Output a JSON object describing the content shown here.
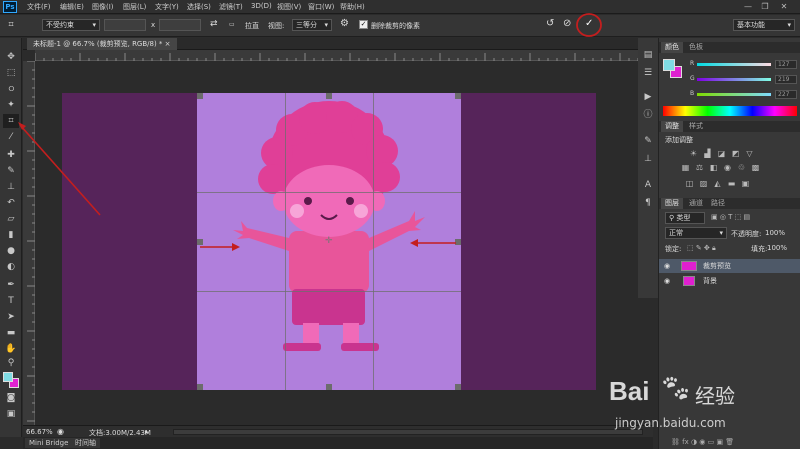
{
  "menubar": {
    "logo": "Ps",
    "items": [
      "文件(F)",
      "编辑(E)",
      "图像(I)",
      "图层(L)",
      "文字(Y)",
      "选择(S)",
      "滤镜(T)",
      "3D(D)",
      "视图(V)",
      "窗口(W)",
      "帮助(H)"
    ],
    "window_controls": [
      "—",
      "❐",
      "✕"
    ]
  },
  "options_bar": {
    "ratio_select": "不受约束",
    "swap_symbol": "x",
    "straighten_label": "拉直",
    "view_label": "视图:",
    "view_select": "三等分",
    "delete_pixels_label": "删除裁剪的像素",
    "workspace_select": "基本功能"
  },
  "document": {
    "tab_title": "未标题-1 @ 66.7% (裁剪预览, RGB/8) *",
    "tab_close": "×"
  },
  "status_bar": {
    "zoom": "66.67%",
    "doc_size": "文档:3.00M/2.43M"
  },
  "bottom_tabs": [
    "Mini Bridge",
    "时间轴"
  ],
  "color_panel": {
    "tabs": [
      "颜色",
      "色板"
    ],
    "channels": [
      {
        "label": "R",
        "value": "127"
      },
      {
        "label": "G",
        "value": "219"
      },
      {
        "label": "B",
        "value": "227"
      }
    ]
  },
  "adjustments_panel": {
    "tabs": [
      "调整",
      "样式"
    ],
    "heading": "添加调整"
  },
  "layers_panel": {
    "tabs": [
      "图层",
      "通道",
      "路径"
    ],
    "filter_select": "类型",
    "blend_mode": "正常",
    "opacity_label": "不透明度:",
    "opacity_value": "100%",
    "lock_label": "锁定:",
    "fill_label": "填充:",
    "fill_value": "100%",
    "layers": [
      {
        "name": "裁剪预览"
      },
      {
        "name": "背景"
      }
    ]
  },
  "watermark": {
    "brand": "Bai",
    "brand_cn": "经验",
    "url": "jingyan.baidu.com"
  },
  "colors": {
    "foreground": "#7fdbe3",
    "background": "#e020d0",
    "image_bg": "#56245a",
    "crop_fill": "#b07fdc",
    "annotation": "#c41e1e"
  }
}
